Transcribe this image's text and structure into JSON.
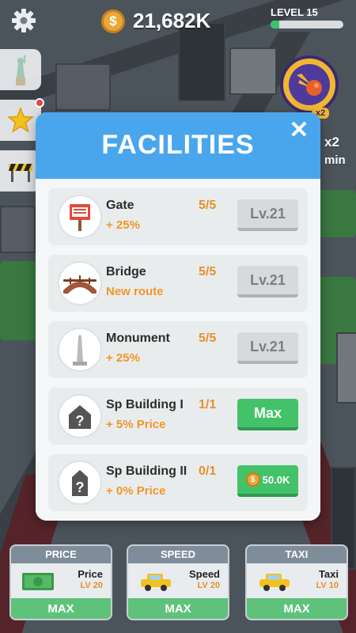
{
  "hud": {
    "money": "21,682K",
    "coin_symbol": "$",
    "level_label": "LEVEL 15",
    "level_progress": 0.12
  },
  "boost": {
    "badge": "x2",
    "multiplier": "x2",
    "time": "min"
  },
  "modal": {
    "title": "FACILITIES",
    "close_symbol": "✕",
    "facilities": [
      {
        "name": "Gate",
        "count": "5/5",
        "effect": "+ 25%",
        "button": "Lv.21",
        "button_type": "level",
        "icon": "gate-sign-icon"
      },
      {
        "name": "Bridge",
        "count": "5/5",
        "effect": "New route",
        "button": "Lv.21",
        "button_type": "level",
        "icon": "bridge-icon"
      },
      {
        "name": "Monument",
        "count": "5/5",
        "effect": "+ 25%",
        "button": "Lv.21",
        "button_type": "level",
        "icon": "monument-icon"
      },
      {
        "name": "Sp Building I",
        "count": "1/1",
        "effect": "+ 5% Price",
        "button": "Max",
        "button_type": "max",
        "icon": "mystery-house-icon"
      },
      {
        "name": "Sp Building II",
        "count": "0/1",
        "effect": "+ 0% Price",
        "button": "50.0K",
        "button_type": "buy",
        "icon": "mystery-house-icon"
      }
    ]
  },
  "upgrades": [
    {
      "header": "PRICE",
      "name": "Price",
      "level": "LV 20",
      "action": "MAX",
      "icon": "money-bill-icon"
    },
    {
      "header": "SPEED",
      "name": "Speed",
      "level": "LV 20",
      "action": "MAX",
      "icon": "taxi-icon"
    },
    {
      "header": "TAXI",
      "name": "Taxi",
      "level": "LV 10",
      "action": "MAX",
      "icon": "taxi-icon"
    }
  ],
  "colors": {
    "modal_header": "#4aa6ec",
    "accent_orange": "#f0962a",
    "max_green": "#43c26a"
  }
}
